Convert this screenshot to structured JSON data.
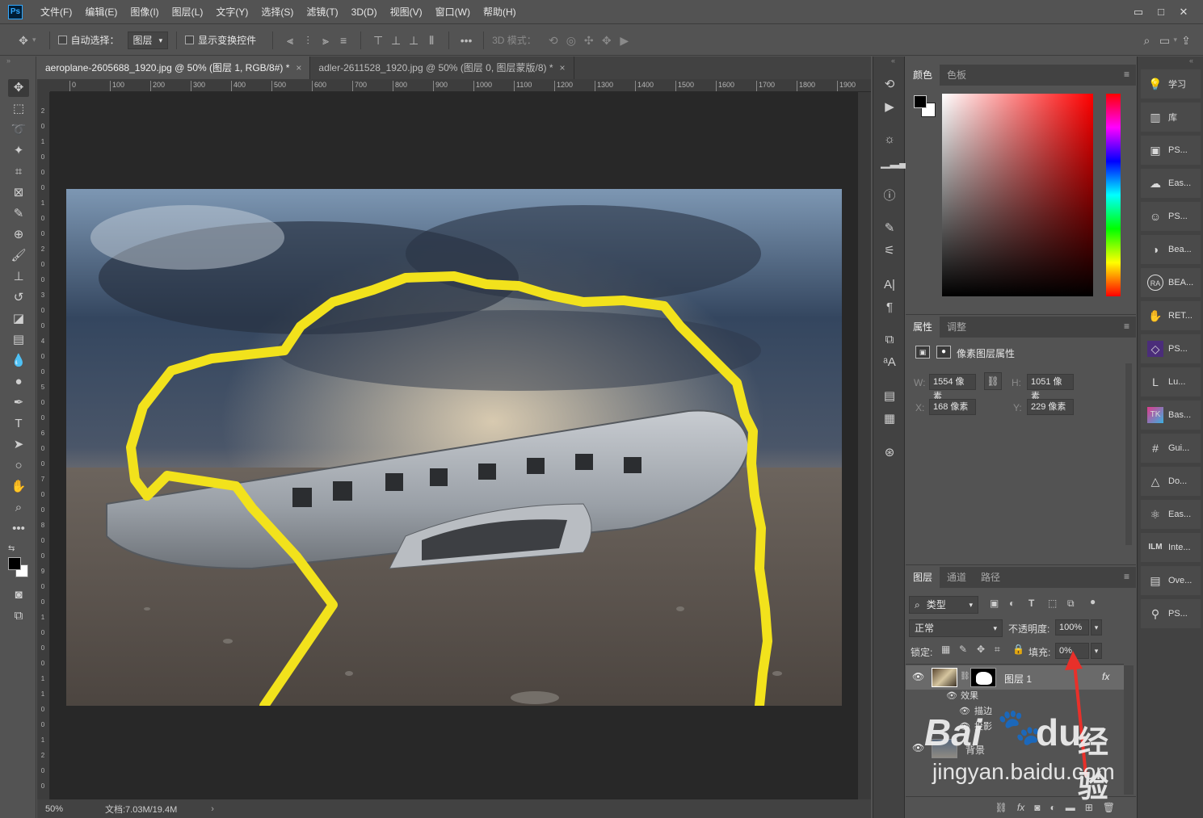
{
  "app": {
    "logo": "Ps"
  },
  "menu": [
    "文件(F)",
    "编辑(E)",
    "图像(I)",
    "图层(L)",
    "文字(Y)",
    "选择(S)",
    "滤镜(T)",
    "3D(D)",
    "视图(V)",
    "窗口(W)",
    "帮助(H)"
  ],
  "window_controls": {
    "minimize": "▭",
    "restore": "□",
    "close": "✕"
  },
  "options": {
    "auto_select_label": "自动选择：",
    "auto_select_target": "图层",
    "show_transform_label": "显示变换控件",
    "mode_3d_label": "3D 模式："
  },
  "tabs": [
    {
      "label": "aeroplane-2605688_1920.jpg @ 50% (图层 1, RGB/8#) *",
      "close": "×"
    },
    {
      "label": "adler-2611528_1920.jpg @ 50% (图层 0, 图层蒙版/8) *",
      "close": "×"
    }
  ],
  "ruler_h": [
    "0",
    "100",
    "200",
    "300",
    "400",
    "500",
    "600",
    "700",
    "800",
    "900",
    "1000",
    "1100",
    "1200",
    "1300",
    "1400",
    "1500",
    "1600",
    "1700",
    "1800",
    "1900"
  ],
  "ruler_v": [
    "2",
    "0",
    "1",
    "0",
    "0",
    "0",
    "1",
    "0",
    "0",
    "2",
    "0",
    "0",
    "3",
    "0",
    "0",
    "4",
    "0",
    "0",
    "5",
    "0",
    "0",
    "6",
    "0",
    "0",
    "7",
    "0",
    "0",
    "8",
    "0",
    "0",
    "9",
    "0",
    "0",
    "1",
    "0",
    "0",
    "0",
    "1",
    "1",
    "0",
    "0",
    "1",
    "2",
    "0",
    "0"
  ],
  "status": {
    "zoom": "50%",
    "doc": "文档:7.03M/19.4M",
    "arrow": "›"
  },
  "color_panel": {
    "tabs": [
      "颜色",
      "色板"
    ],
    "fg_color": "#000000",
    "bg_color": "#ffffff",
    "hue_color": "#ff0000"
  },
  "properties_panel": {
    "tabs": [
      "属性",
      "调整"
    ],
    "title": "像素图层属性",
    "w_label": "W:",
    "w_value": "1554 像素",
    "h_label": "H:",
    "h_value": "1051 像素",
    "x_label": "X:",
    "x_value": "168 像素",
    "y_label": "Y:",
    "y_value": "229 像素"
  },
  "layers_panel": {
    "tabs": [
      "图层",
      "通道",
      "路径"
    ],
    "filter_type": "类型",
    "blend_mode": "正常",
    "opacity_label": "不透明度:",
    "opacity_value": "100%",
    "lock_label": "锁定:",
    "fill_label": "填充:",
    "fill_value": "0%",
    "layer1_name": "图层 1",
    "fx": "fx",
    "effects_label": "效果",
    "effect_stroke": "描边",
    "effect_shadow": "投影",
    "background_name": "背景"
  },
  "right_list": [
    "学习",
    "库",
    "PS...",
    "Eas...",
    "PS...",
    "Bea...",
    "BEA...",
    "RET...",
    "PS...",
    "Lu...",
    "Bas...",
    "Gui...",
    "Do...",
    "Eas...",
    "Inte...",
    "Ove...",
    "PS..."
  ],
  "watermark": {
    "brand": "Bai",
    "brand2": "du",
    "product": "经验",
    "url": "jingyan.baidu.com"
  },
  "highlight_color": "#f2e21c",
  "arrow_color": "#e8302a"
}
